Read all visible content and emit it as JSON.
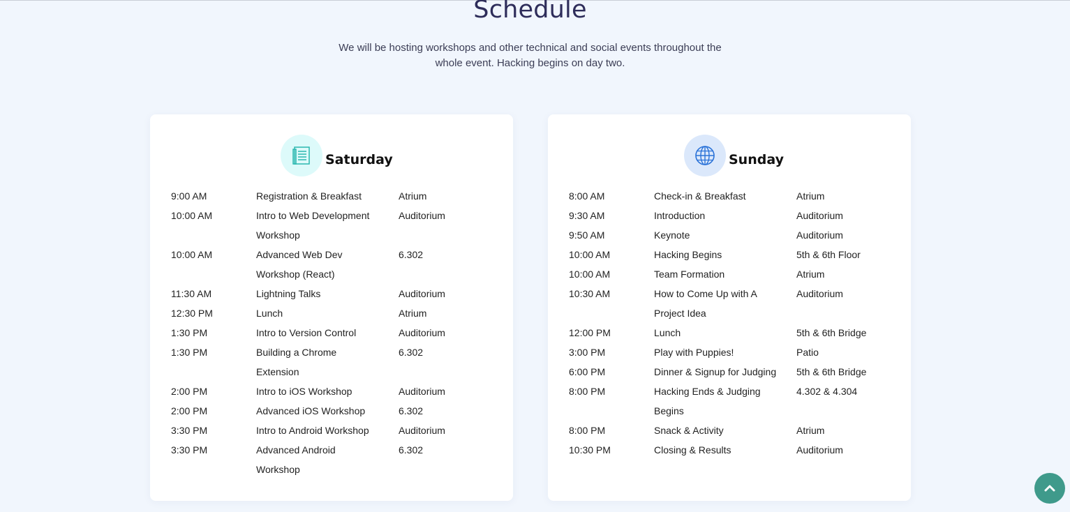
{
  "section": {
    "title": "Schedule",
    "subtitle": "We will be hosting workshops and other technical and social events throughout the whole event. Hacking begins on day two."
  },
  "saturday": {
    "title": "Saturday",
    "icon": "document-list-icon",
    "events": [
      {
        "time": "9:00 AM",
        "event": "Registration & Breakfast",
        "location": "Atrium"
      },
      {
        "time": "10:00 AM",
        "event": "Intro to Web Development Workshop",
        "location": "Auditorium"
      },
      {
        "time": "10:00 AM",
        "event": "Advanced Web Dev Workshop (React)",
        "location": "6.302"
      },
      {
        "time": "11:30 AM",
        "event": "Lightning Talks",
        "location": "Auditorium"
      },
      {
        "time": "12:30 PM",
        "event": "Lunch",
        "location": "Atrium"
      },
      {
        "time": "1:30 PM",
        "event": "Intro to Version Control",
        "location": "Auditorium"
      },
      {
        "time": "1:30 PM",
        "event": "Building a Chrome Extension",
        "location": "6.302"
      },
      {
        "time": "2:00 PM",
        "event": "Intro to iOS Workshop",
        "location": "Auditorium"
      },
      {
        "time": "2:00 PM",
        "event": "Advanced iOS Workshop",
        "location": "6.302"
      },
      {
        "time": "3:30 PM",
        "event": "Intro to Android Workshop",
        "location": "Auditorium"
      },
      {
        "time": "3:30 PM",
        "event": "Advanced Android Workshop",
        "location": "6.302"
      }
    ]
  },
  "sunday": {
    "title": "Sunday",
    "icon": "globe-icon",
    "events": [
      {
        "time": "8:00 AM",
        "event": "Check-in & Breakfast",
        "location": "Atrium"
      },
      {
        "time": "9:30 AM",
        "event": "Introduction",
        "location": "Auditorium"
      },
      {
        "time": "9:50 AM",
        "event": "Keynote",
        "location": "Auditorium"
      },
      {
        "time": "10:00 AM",
        "event": "Hacking Begins",
        "location": "5th & 6th Floor"
      },
      {
        "time": "10:00 AM",
        "event": "Team Formation",
        "location": "Atrium"
      },
      {
        "time": "10:30 AM",
        "event": "How to Come Up with A Project Idea",
        "location": "Auditorium"
      },
      {
        "time": "12:00 PM",
        "event": "Lunch",
        "location": "5th & 6th Bridge"
      },
      {
        "time": "3:00 PM",
        "event": "Play with Puppies!",
        "location": "Patio"
      },
      {
        "time": "6:00 PM",
        "event": "Dinner & Signup for Judging",
        "location": "5th & 6th Bridge"
      },
      {
        "time": "8:00 PM",
        "event": "Hacking Ends & Judging Begins",
        "location": "4.302 & 4.304"
      },
      {
        "time": "8:00 PM",
        "event": "Snack & Activity",
        "location": "Atrium"
      },
      {
        "time": "10:30 PM",
        "event": "Closing & Results",
        "location": "Auditorium"
      }
    ]
  },
  "scroll_top": {
    "icon": "chevron-up-icon"
  },
  "colors": {
    "background": "#f1f6fd",
    "heading": "#2e2d5a",
    "saturday_icon_bg": "#ddfafa",
    "saturday_icon": "#2bb8b0",
    "sunday_icon_bg": "#dbe8fb",
    "sunday_icon": "#2a72d8",
    "scroll_button": "#3f9a8b"
  }
}
